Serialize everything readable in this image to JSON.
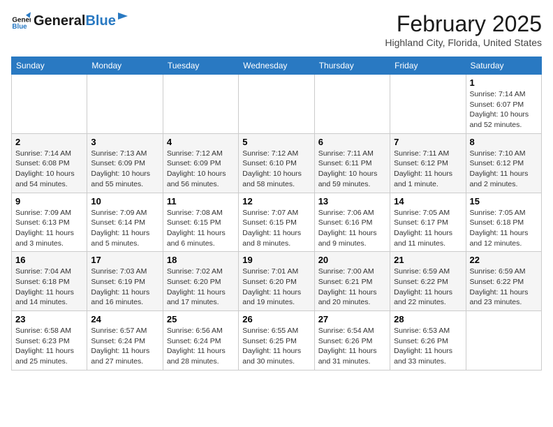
{
  "header": {
    "logo_line1": "General",
    "logo_line2": "Blue",
    "month": "February 2025",
    "location": "Highland City, Florida, United States"
  },
  "days_of_week": [
    "Sunday",
    "Monday",
    "Tuesday",
    "Wednesday",
    "Thursday",
    "Friday",
    "Saturday"
  ],
  "weeks": [
    [
      {
        "num": "",
        "info": ""
      },
      {
        "num": "",
        "info": ""
      },
      {
        "num": "",
        "info": ""
      },
      {
        "num": "",
        "info": ""
      },
      {
        "num": "",
        "info": ""
      },
      {
        "num": "",
        "info": ""
      },
      {
        "num": "1",
        "info": "Sunrise: 7:14 AM\nSunset: 6:07 PM\nDaylight: 10 hours and 52 minutes."
      }
    ],
    [
      {
        "num": "2",
        "info": "Sunrise: 7:14 AM\nSunset: 6:08 PM\nDaylight: 10 hours and 54 minutes."
      },
      {
        "num": "3",
        "info": "Sunrise: 7:13 AM\nSunset: 6:09 PM\nDaylight: 10 hours and 55 minutes."
      },
      {
        "num": "4",
        "info": "Sunrise: 7:12 AM\nSunset: 6:09 PM\nDaylight: 10 hours and 56 minutes."
      },
      {
        "num": "5",
        "info": "Sunrise: 7:12 AM\nSunset: 6:10 PM\nDaylight: 10 hours and 58 minutes."
      },
      {
        "num": "6",
        "info": "Sunrise: 7:11 AM\nSunset: 6:11 PM\nDaylight: 10 hours and 59 minutes."
      },
      {
        "num": "7",
        "info": "Sunrise: 7:11 AM\nSunset: 6:12 PM\nDaylight: 11 hours and 1 minute."
      },
      {
        "num": "8",
        "info": "Sunrise: 7:10 AM\nSunset: 6:12 PM\nDaylight: 11 hours and 2 minutes."
      }
    ],
    [
      {
        "num": "9",
        "info": "Sunrise: 7:09 AM\nSunset: 6:13 PM\nDaylight: 11 hours and 3 minutes."
      },
      {
        "num": "10",
        "info": "Sunrise: 7:09 AM\nSunset: 6:14 PM\nDaylight: 11 hours and 5 minutes."
      },
      {
        "num": "11",
        "info": "Sunrise: 7:08 AM\nSunset: 6:15 PM\nDaylight: 11 hours and 6 minutes."
      },
      {
        "num": "12",
        "info": "Sunrise: 7:07 AM\nSunset: 6:15 PM\nDaylight: 11 hours and 8 minutes."
      },
      {
        "num": "13",
        "info": "Sunrise: 7:06 AM\nSunset: 6:16 PM\nDaylight: 11 hours and 9 minutes."
      },
      {
        "num": "14",
        "info": "Sunrise: 7:05 AM\nSunset: 6:17 PM\nDaylight: 11 hours and 11 minutes."
      },
      {
        "num": "15",
        "info": "Sunrise: 7:05 AM\nSunset: 6:18 PM\nDaylight: 11 hours and 12 minutes."
      }
    ],
    [
      {
        "num": "16",
        "info": "Sunrise: 7:04 AM\nSunset: 6:18 PM\nDaylight: 11 hours and 14 minutes."
      },
      {
        "num": "17",
        "info": "Sunrise: 7:03 AM\nSunset: 6:19 PM\nDaylight: 11 hours and 16 minutes."
      },
      {
        "num": "18",
        "info": "Sunrise: 7:02 AM\nSunset: 6:20 PM\nDaylight: 11 hours and 17 minutes."
      },
      {
        "num": "19",
        "info": "Sunrise: 7:01 AM\nSunset: 6:20 PM\nDaylight: 11 hours and 19 minutes."
      },
      {
        "num": "20",
        "info": "Sunrise: 7:00 AM\nSunset: 6:21 PM\nDaylight: 11 hours and 20 minutes."
      },
      {
        "num": "21",
        "info": "Sunrise: 6:59 AM\nSunset: 6:22 PM\nDaylight: 11 hours and 22 minutes."
      },
      {
        "num": "22",
        "info": "Sunrise: 6:59 AM\nSunset: 6:22 PM\nDaylight: 11 hours and 23 minutes."
      }
    ],
    [
      {
        "num": "23",
        "info": "Sunrise: 6:58 AM\nSunset: 6:23 PM\nDaylight: 11 hours and 25 minutes."
      },
      {
        "num": "24",
        "info": "Sunrise: 6:57 AM\nSunset: 6:24 PM\nDaylight: 11 hours and 27 minutes."
      },
      {
        "num": "25",
        "info": "Sunrise: 6:56 AM\nSunset: 6:24 PM\nDaylight: 11 hours and 28 minutes."
      },
      {
        "num": "26",
        "info": "Sunrise: 6:55 AM\nSunset: 6:25 PM\nDaylight: 11 hours and 30 minutes."
      },
      {
        "num": "27",
        "info": "Sunrise: 6:54 AM\nSunset: 6:26 PM\nDaylight: 11 hours and 31 minutes."
      },
      {
        "num": "28",
        "info": "Sunrise: 6:53 AM\nSunset: 6:26 PM\nDaylight: 11 hours and 33 minutes."
      },
      {
        "num": "",
        "info": ""
      }
    ]
  ]
}
